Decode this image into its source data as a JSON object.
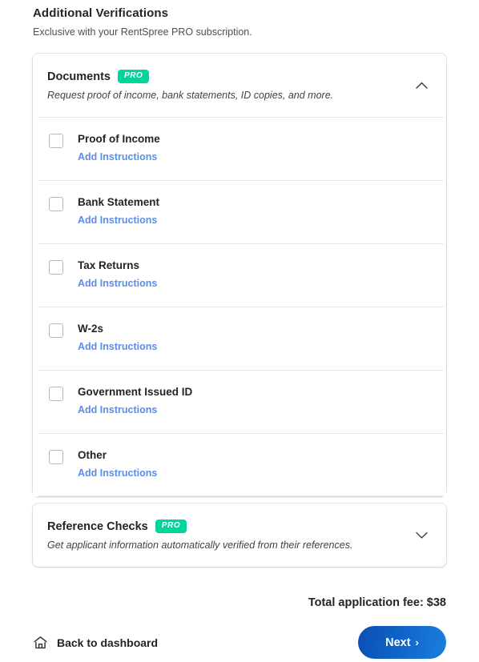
{
  "section": {
    "title": "Additional Verifications",
    "subtitle": "Exclusive with your RentSpree PRO subscription."
  },
  "colors": {
    "pro_badge": "#00d69a",
    "link": "#5b8cea",
    "next_button_gradient_start": "#0c4fb3",
    "next_button_gradient_end": "#1a7fdd",
    "divider": "#e6e8ec",
    "checkbox_border": "#b3b8c0"
  },
  "documents_card": {
    "title": "Documents",
    "badge": "PRO",
    "description": "Request proof of income, bank statements, ID copies, and more.",
    "expanded": true,
    "toggle_icon": "chevron-up-icon",
    "rows": [
      {
        "label": "Proof of Income",
        "link": "Add Instructions",
        "checked": false
      },
      {
        "label": "Bank Statement",
        "link": "Add Instructions",
        "checked": false
      },
      {
        "label": "Tax Returns",
        "link": "Add Instructions",
        "checked": false
      },
      {
        "label": "W-2s",
        "link": "Add Instructions",
        "checked": false
      },
      {
        "label": "Government Issued ID",
        "link": "Add Instructions",
        "checked": false
      },
      {
        "label": "Other",
        "link": "Add Instructions",
        "checked": false
      }
    ]
  },
  "reference_checks_card": {
    "title": "Reference Checks",
    "badge": "PRO",
    "description": "Get applicant information automatically verified from their references.",
    "expanded": false,
    "toggle_icon": "chevron-down-icon"
  },
  "footer": {
    "fee_text": "Total application fee: $38",
    "back_label": "Back to dashboard",
    "back_icon": "home-icon",
    "next_label": "Next",
    "next_icon": "chevron-right-icon"
  }
}
